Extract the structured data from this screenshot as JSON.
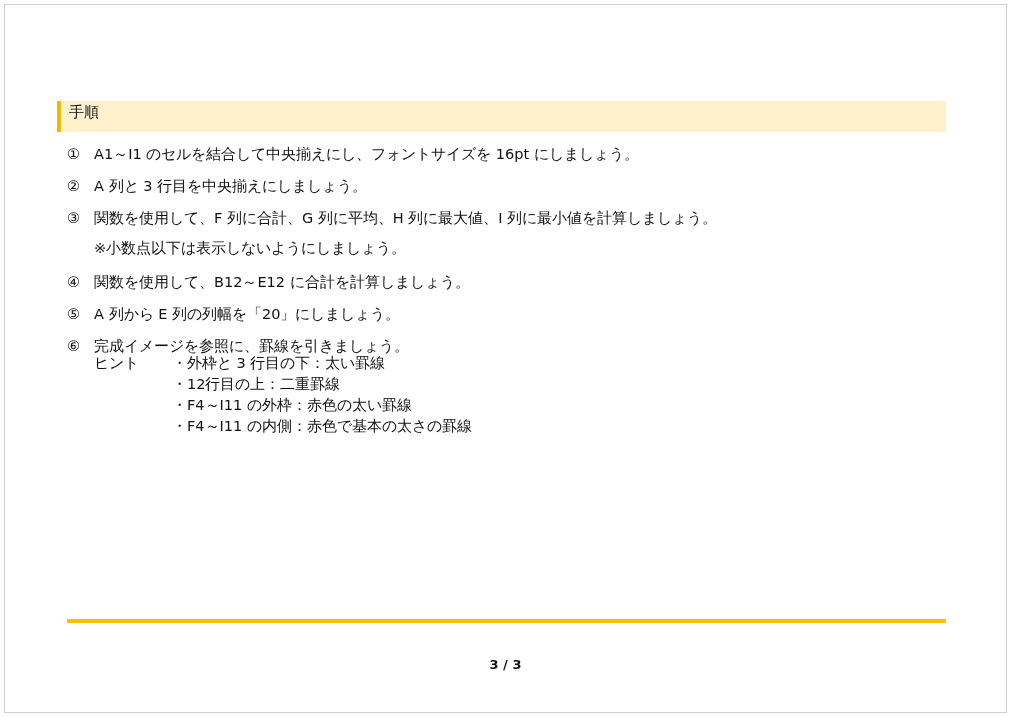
{
  "heading": "手順",
  "steps": [
    {
      "number": "①",
      "text": "A1～I1 のセルを結合して中央揃えにし、フォントサイズを 16pt にしましょう。"
    },
    {
      "number": "②",
      "text": "A 列と 3 行目を中央揃えにしましょう。"
    },
    {
      "number": "③",
      "text": "関数を使用して、F 列に合計、G 列に平均、H 列に最大値、I 列に最小値を計算しましょう。",
      "note": "※小数点以下は表示しないようにしましょう。"
    },
    {
      "number": "④",
      "text": "関数を使用して、B12～E12 に合計を計算しましょう。"
    },
    {
      "number": "⑤",
      "text": "A 列から E 列の列幅を「20」にしましょう。"
    },
    {
      "number": "⑥",
      "text": "完成イメージを参照に、罫線を引きましょう。",
      "hint": {
        "label": "ヒント",
        "items": [
          "・外枠と 3 行目の下：太い罫線",
          "・12行目の上：二重罫線",
          "・F4～I11 の外枠：赤色の太い罫線",
          "・F4～I11 の内側：赤色で基本の太さの罫線"
        ]
      }
    }
  ],
  "page_number": "3 / 3"
}
